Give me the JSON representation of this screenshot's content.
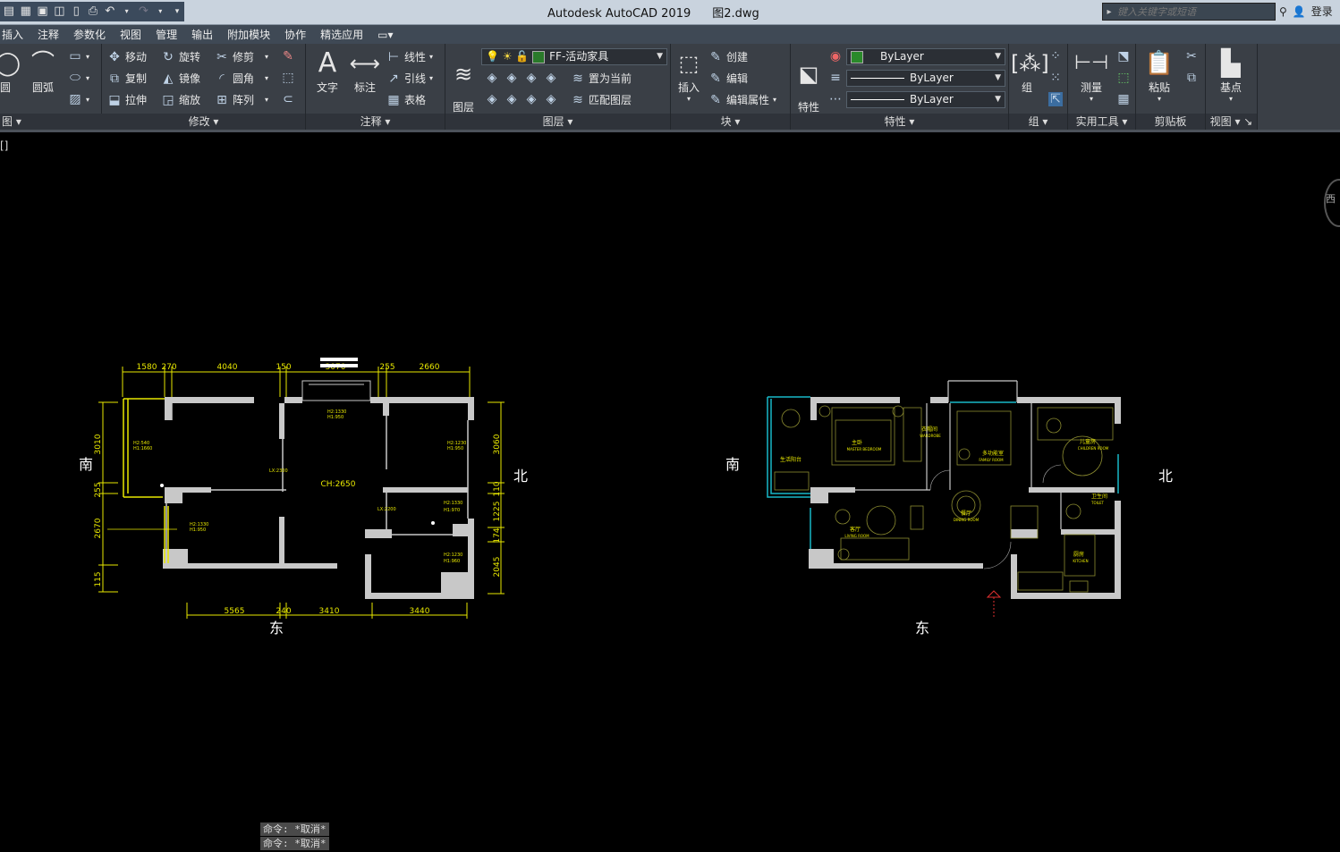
{
  "titlebar": {
    "app": "Autodesk AutoCAD 2019",
    "file": "图2.dwg"
  },
  "search": {
    "placeholder": "键入关键字或短语"
  },
  "user": {
    "login": "登录"
  },
  "menu": [
    "插入",
    "注释",
    "参数化",
    "视图",
    "管理",
    "输出",
    "附加模块",
    "协作",
    "精选应用"
  ],
  "ribbon": {
    "draw": {
      "title": "图",
      "arc": "圆弧",
      "circle": "圆"
    },
    "modify": {
      "title": "修改",
      "move": "移动",
      "rotate": "旋转",
      "trim": "修剪",
      "copy": "复制",
      "mirror": "镜像",
      "fillet": "圆角",
      "stretch": "拉伸",
      "scale": "缩放",
      "array": "阵列"
    },
    "annotation": {
      "title": "注释",
      "text": "文字",
      "dimension": "标注",
      "linear": "线性",
      "leader": "引线",
      "table": "表格"
    },
    "layers": {
      "title": "图层",
      "layer_props": "图层\n特性",
      "current_layer": "FF-活动家具",
      "set_current": "置为当前",
      "match_layer": "匹配图层"
    },
    "block": {
      "title": "块",
      "insert": "插入",
      "create": "创建",
      "edit": "编辑",
      "edit_attr": "编辑属性"
    },
    "properties": {
      "title": "特性",
      "match": "特性\n匹配",
      "color": "ByLayer",
      "linetype": "ByLayer",
      "lineweight": "ByLayer"
    },
    "group": {
      "title": "组",
      "group": "组"
    },
    "utilities": {
      "title": "实用工具",
      "measure": "测量"
    },
    "clipboard": {
      "title": "剪贴板",
      "paste": "粘贴"
    },
    "view": {
      "title": "视图",
      "base": "基点"
    }
  },
  "viewport": {
    "label": "[]",
    "viewcube_label": "西"
  },
  "plan1": {
    "compass": {
      "south": "南",
      "north": "北",
      "east": "东"
    },
    "top_dims": [
      "1580",
      "270",
      "4040",
      "150",
      "3070",
      "255",
      "2660"
    ],
    "bottom_dims": [
      "5565",
      "240",
      "3410",
      "3440"
    ],
    "left_dims": [
      "3010",
      "255",
      "2670",
      "115"
    ],
    "right_dims": [
      "3060",
      "110",
      "1225",
      "174",
      "2045"
    ],
    "ceiling": "CH:2650",
    "notes": [
      "H2:1330",
      "H1:950",
      "H2:540",
      "H1:1660",
      "LX:2300",
      "H2:1230",
      "H1:950",
      "H2:1330",
      "H1:950",
      "H2:1330",
      "H1:970",
      "LX:2200",
      "H2:1230",
      "H1:960"
    ]
  },
  "plan2": {
    "compass": {
      "south": "南",
      "north": "北",
      "east": "东"
    },
    "rooms": [
      {
        "cn": "生活阳台",
        "en": ""
      },
      {
        "cn": "主卧",
        "en": "MASTER BEDROOM"
      },
      {
        "cn": "衣帽间",
        "en": "WARDROBE"
      },
      {
        "cn": "多功能室",
        "en": "FAMILY ROOM"
      },
      {
        "cn": "儿童房",
        "en": "CHILDREN ROOM"
      },
      {
        "cn": "卫生间",
        "en": "TOILET"
      },
      {
        "cn": "客厅",
        "en": "LIVING ROOM"
      },
      {
        "cn": "餐厅",
        "en": "DINING ROOM"
      },
      {
        "cn": "厨房",
        "en": "KITCHEN"
      }
    ]
  },
  "command": {
    "line1": "命令: *取消*",
    "line2": "命令: *取消*"
  },
  "colors": {
    "wall": "#c8c8c8",
    "dim": "#e8e800",
    "cyan": "#18b8c8",
    "furniture": "#9a9a2a",
    "ribbon": "#3a3f46"
  }
}
